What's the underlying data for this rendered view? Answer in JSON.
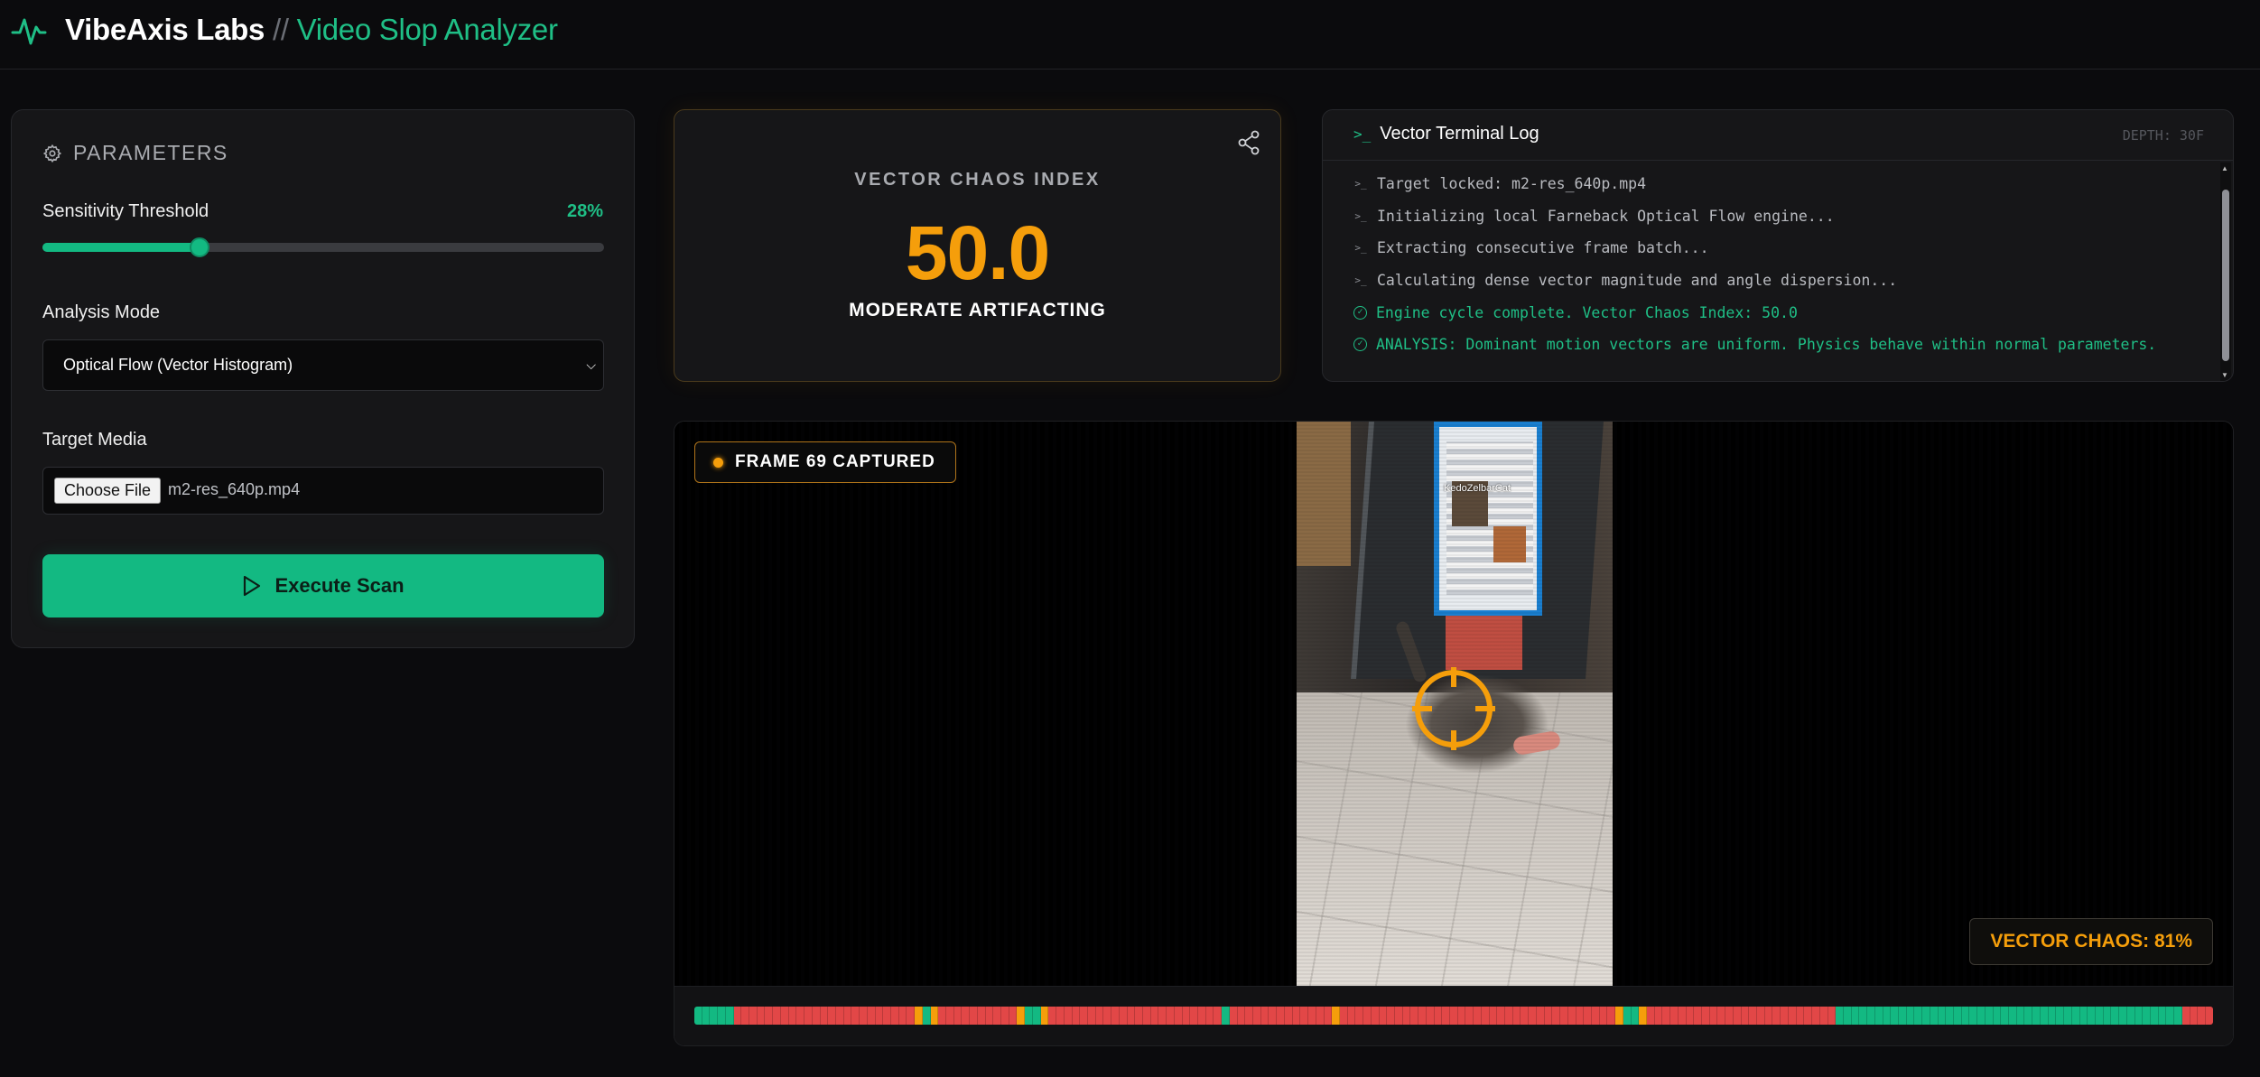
{
  "header": {
    "brand": "VibeAxis Labs",
    "separator": " // ",
    "subtitle": "Video Slop Analyzer",
    "logo_icon": "pulse-icon"
  },
  "parameters": {
    "title": "PARAMETERS",
    "icon": "gear-icon",
    "sensitivity_label": "Sensitivity Threshold",
    "sensitivity_value": "28%",
    "sensitivity_fraction": 0.28,
    "mode_label": "Analysis Mode",
    "mode_value": "Optical Flow (Vector Histogram)",
    "media_label": "Target Media",
    "file_button": "Choose File",
    "file_name": "m2-res_640p.mp4",
    "execute_label": "Execute Scan"
  },
  "score": {
    "label": "VECTOR CHAOS INDEX",
    "value": "50.0",
    "verdict": "MODERATE ARTIFACTING"
  },
  "terminal": {
    "title": "Vector Terminal Log",
    "depth": "DEPTH: 30F",
    "lines": [
      {
        "type": "info",
        "text": "Target locked: m2-res_640p.mp4"
      },
      {
        "type": "info",
        "text": "Initializing local Farneback Optical Flow engine..."
      },
      {
        "type": "info",
        "text": "Extracting consecutive frame batch..."
      },
      {
        "type": "info",
        "text": "Calculating dense vector magnitude and angle dispersion..."
      },
      {
        "type": "ok",
        "text": "Engine cycle complete. Vector Chaos Index: 50.0"
      },
      {
        "type": "ok",
        "text": "ANALYSIS: Dominant motion vectors are uniform. Physics behave within normal parameters."
      }
    ]
  },
  "video": {
    "frame_badge": "FRAME 69 CAPTURED",
    "watermark": "KedoZelbarCat",
    "chaos_readout": "VECTOR CHAOS: 81%",
    "timeline": "GGGGGRRRRRRRRRRRRRRRRRRRRRRRYGYRRRRRRRRRRYGGYRRRRRRRRRRRRRRRRRRRRRRGRRRRRRRRRRRRRYRRRRRRRRRRRRRRRRRRRRRRRRRRRRRRRRRRRYGGYRRRRRRRRRRRRRRRRRRRRRRRRGGGGGGGGGGGGGGGGGGGGGGGGGGGGGGGGGGGGGGGGGGGGRRRR",
    "colors": {
      "green": "#13b982",
      "red": "#e24747",
      "amber": "#f59e0b"
    }
  }
}
